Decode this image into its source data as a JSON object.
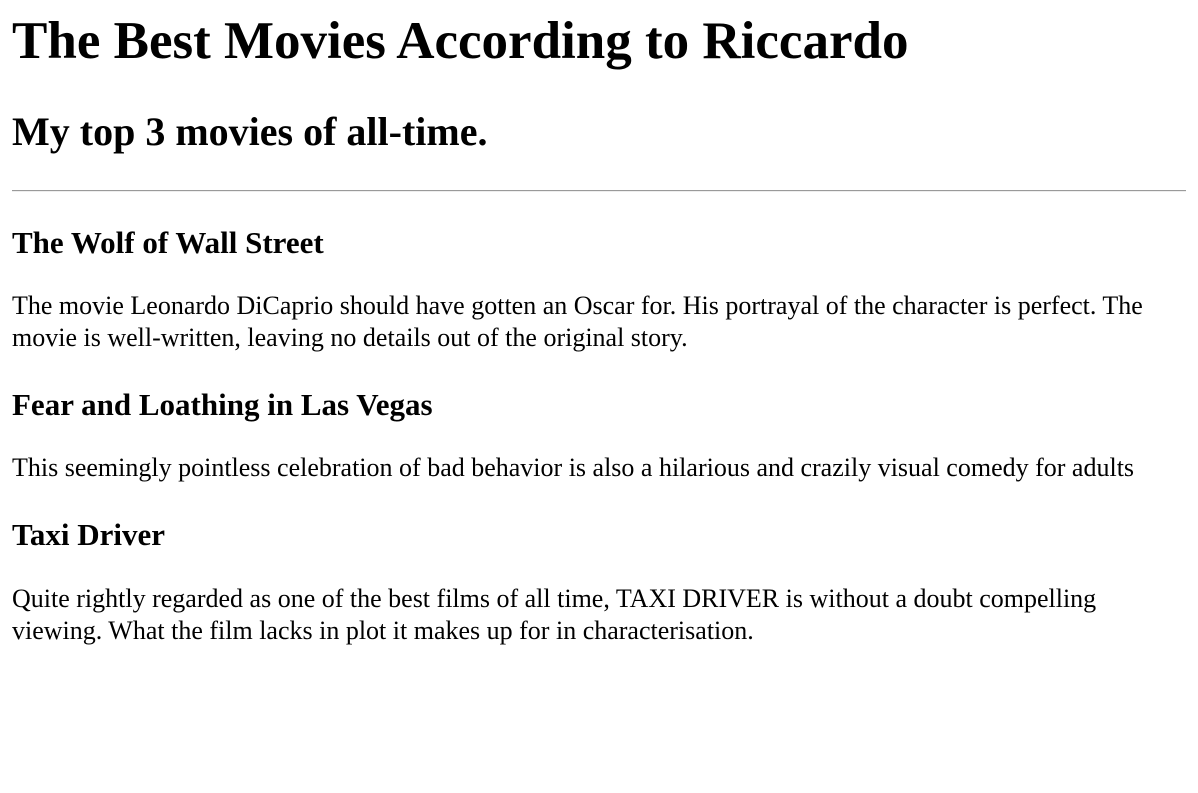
{
  "header": {
    "title": "The Best Movies According to Riccardo",
    "subtitle": "My top 3 movies of all-time."
  },
  "movies": [
    {
      "title": "The Wolf of Wall Street",
      "description": "The movie Leonardo DiCaprio should have gotten an Oscar for. His portrayal of the character is perfect. The movie is well-written, leaving no details out of the original story."
    },
    {
      "title": "Fear and Loathing in Las Vegas",
      "description": "This seemingly pointless celebration of bad behavior is also a hilarious and crazily visual comedy for adults"
    },
    {
      "title": "Taxi Driver",
      "description": "Quite rightly regarded as one of the best films of all time, TAXI DRIVER is without a doubt compelling viewing. What the film lacks in plot it makes up for in characterisation."
    }
  ]
}
